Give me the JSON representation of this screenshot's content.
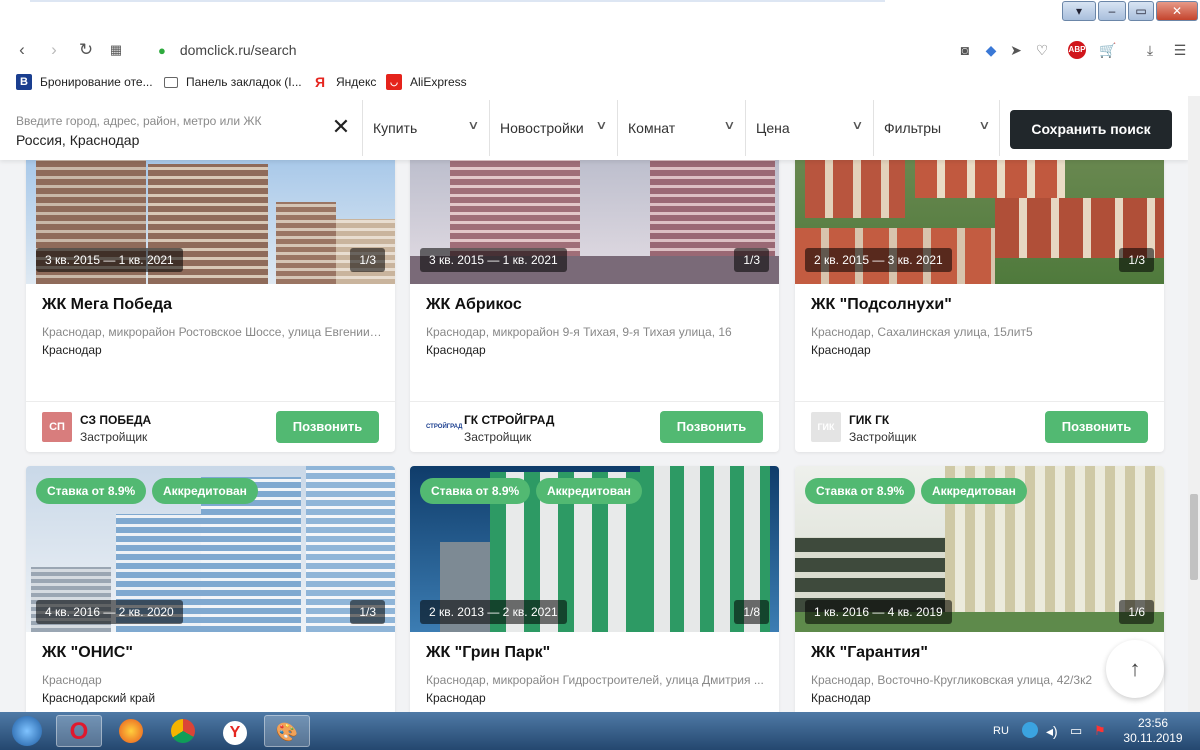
{
  "browser": {
    "url": "domclick.ru/search",
    "window_controls": {
      "minimize": "–",
      "maximize": "▭",
      "close": "✕"
    },
    "icons": [
      "back-icon",
      "forward-icon",
      "reload-icon",
      "grid-icon",
      "lock-icon",
      "camera-icon",
      "shield-icon",
      "send-icon",
      "heart-icon",
      "abp-icon",
      "cart-icon",
      "download-icon",
      "menu-icon"
    ],
    "abp_label": "ABP",
    "bookmarks": [
      {
        "label": "Бронирование оте...",
        "icon": "B",
        "color": "#1a3e8f"
      },
      {
        "label": "Панель закладок (I...",
        "icon": "folder",
        "color": "#555"
      },
      {
        "label": "Яндекс",
        "icon": "Я",
        "color": "#e52620"
      },
      {
        "label": "AliExpress",
        "icon": "ali",
        "color": "#e5231b"
      }
    ]
  },
  "search": {
    "placeholder": "Введите город, адрес, район, метро или ЖК",
    "value": "Россия, Краснодар",
    "clear_icon": "✕",
    "filters": [
      {
        "label": "Купить"
      },
      {
        "label": "Новостройки"
      },
      {
        "label": "Комнат"
      },
      {
        "label": "Цена"
      },
      {
        "label": "Фильтры"
      }
    ],
    "save_label": "Сохранить поиск"
  },
  "cards_top": [
    {
      "period": "3 кв. 2015 — 1 кв. 2021",
      "count": "1/3",
      "title": "ЖК Мега Победа",
      "address": "Краснодар, микрорайон Ростовское Шоссе, улица Евгении ...",
      "city": "Краснодар",
      "developer": "СЗ ПОБЕДА",
      "developer_logo": "СП",
      "role": "Застройщик",
      "call": "Позвонить"
    },
    {
      "period": "3 кв. 2015 — 1 кв. 2021",
      "count": "1/3",
      "title": "ЖК Абрикос",
      "address": "Краснодар, микрорайон 9-я Тихая, 9-я Тихая улица, 16",
      "city": "Краснодар",
      "developer": "ГК СТРОЙГРАД",
      "developer_logo": "СТРОЙГРАД",
      "role": "Застройщик",
      "call": "Позвонить"
    },
    {
      "period": "2 кв. 2015 — 3 кв. 2021",
      "count": "1/3",
      "title": "ЖК \"Подсолнухи\"",
      "address": "Краснодар, Сахалинская улица, 15лит5",
      "city": "Краснодар",
      "developer": "ГИК ГК",
      "developer_logo": "ГИК",
      "role": "Застройщик",
      "call": "Позвонить"
    }
  ],
  "cards_bottom": [
    {
      "rate": "Ставка от 8.9%",
      "accredited": "Аккредитован",
      "period": "4 кв. 2016 — 2 кв. 2020",
      "count": "1/3",
      "title": "ЖК \"ОНИС\"",
      "address": "Краснодар",
      "city": "Краснодарский край"
    },
    {
      "rate": "Ставка от 8.9%",
      "accredited": "Аккредитован",
      "period": "2 кв. 2013 — 2 кв. 2021",
      "count": "1/8",
      "title": "ЖК \"Грин Парк\"",
      "address": "Краснодар, микрорайон Гидростроителей, улица Дмитрия ...",
      "city": "Краснодар"
    },
    {
      "rate": "Ставка от 8.9%",
      "accredited": "Аккредитован",
      "period": "1 кв. 2016 — 4 кв. 2019",
      "count": "1/6",
      "title": "ЖК \"Гарантия\"",
      "address": "Краснодар, Восточно-Кругликовская улица, 42/3к2",
      "city": "Краснодар"
    }
  ],
  "scroll_up_icon": "↑",
  "taskbar": {
    "lang": "RU",
    "time": "23:56",
    "date": "30.11.2019"
  }
}
